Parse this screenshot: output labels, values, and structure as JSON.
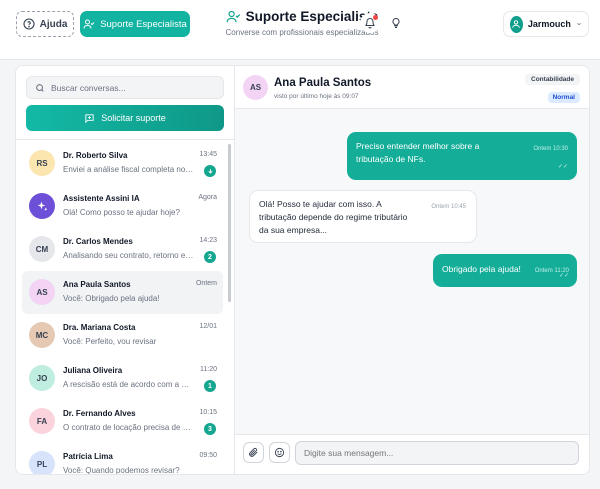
{
  "header": {
    "help_label": "Ajuda",
    "specialist_button_label": "Suporte Especialista",
    "title": "Suporte Especialista",
    "subtitle": "Converse com profissionais especializados",
    "user_name": "Jarmouch"
  },
  "sidebar": {
    "search_placeholder": "Buscar conversas...",
    "request_button_label": "Solicitar suporte",
    "conversations": [
      {
        "initials": "RS",
        "name": "Dr. Roberto Silva",
        "time": "13:45",
        "preview": "Enviei a análise fiscal completa no anexo.",
        "badge": "download-icon",
        "avatar_color": "#fbe6b0"
      },
      {
        "initials": "",
        "name": "Assistente Assini IA",
        "time": "Agora",
        "preview": "Olá! Como posso te ajudar hoje?",
        "badge": "",
        "avatar_color": "#6d4fd8"
      },
      {
        "initials": "CM",
        "name": "Dr. Carlos Mendes",
        "time": "14:23",
        "preview": "Analisando seu contrato, retorno em breve",
        "badge": "2",
        "avatar_color": "#e5e7eb"
      },
      {
        "initials": "AS",
        "name": "Ana Paula Santos",
        "time": "Ontem",
        "preview": "Você: Obrigado pela ajuda!",
        "badge": "",
        "avatar_color": "#f3d4f5"
      },
      {
        "initials": "MC",
        "name": "Dra. Mariana Costa",
        "time": "12/01",
        "preview": "Você: Perfeito, vou revisar",
        "badge": "",
        "avatar_color": "#e6c9b3"
      },
      {
        "initials": "JO",
        "name": "Juliana Oliveira",
        "time": "11:20",
        "preview": "A rescisão está de acordo com a CLT",
        "badge": "1",
        "avatar_color": "#bfeee0"
      },
      {
        "initials": "FA",
        "name": "Dr. Fernando Alves",
        "time": "10:15",
        "preview": "O contrato de locação precisa de ajustes",
        "badge": "3",
        "avatar_color": "#fbd3dc"
      },
      {
        "initials": "PL",
        "name": "Patrícia Lima",
        "time": "09:50",
        "preview": "Você: Quando podemos revisar?",
        "badge": "",
        "avatar_color": "#d7e3fb"
      }
    ]
  },
  "chat": {
    "contact_initials": "AS",
    "contact_name": "Ana Paula Santos",
    "last_seen": "visto por último hoje às 09:07",
    "category": "Contabilidade",
    "priority": "Normal",
    "messages": [
      {
        "direction": "out",
        "text": "Preciso entender melhor sobre a tributação de NFs.",
        "time": "Ontem 10:30"
      },
      {
        "direction": "in",
        "text": "Olá! Posso te ajudar com isso. A tributação depende do regime tributário da sua empresa...",
        "time": "Ontem 10:45"
      },
      {
        "direction": "out",
        "text": "Obrigado pela ajuda!",
        "time": "Ontem 11:20"
      }
    ],
    "input_placeholder": "Digite sua mensagem..."
  }
}
